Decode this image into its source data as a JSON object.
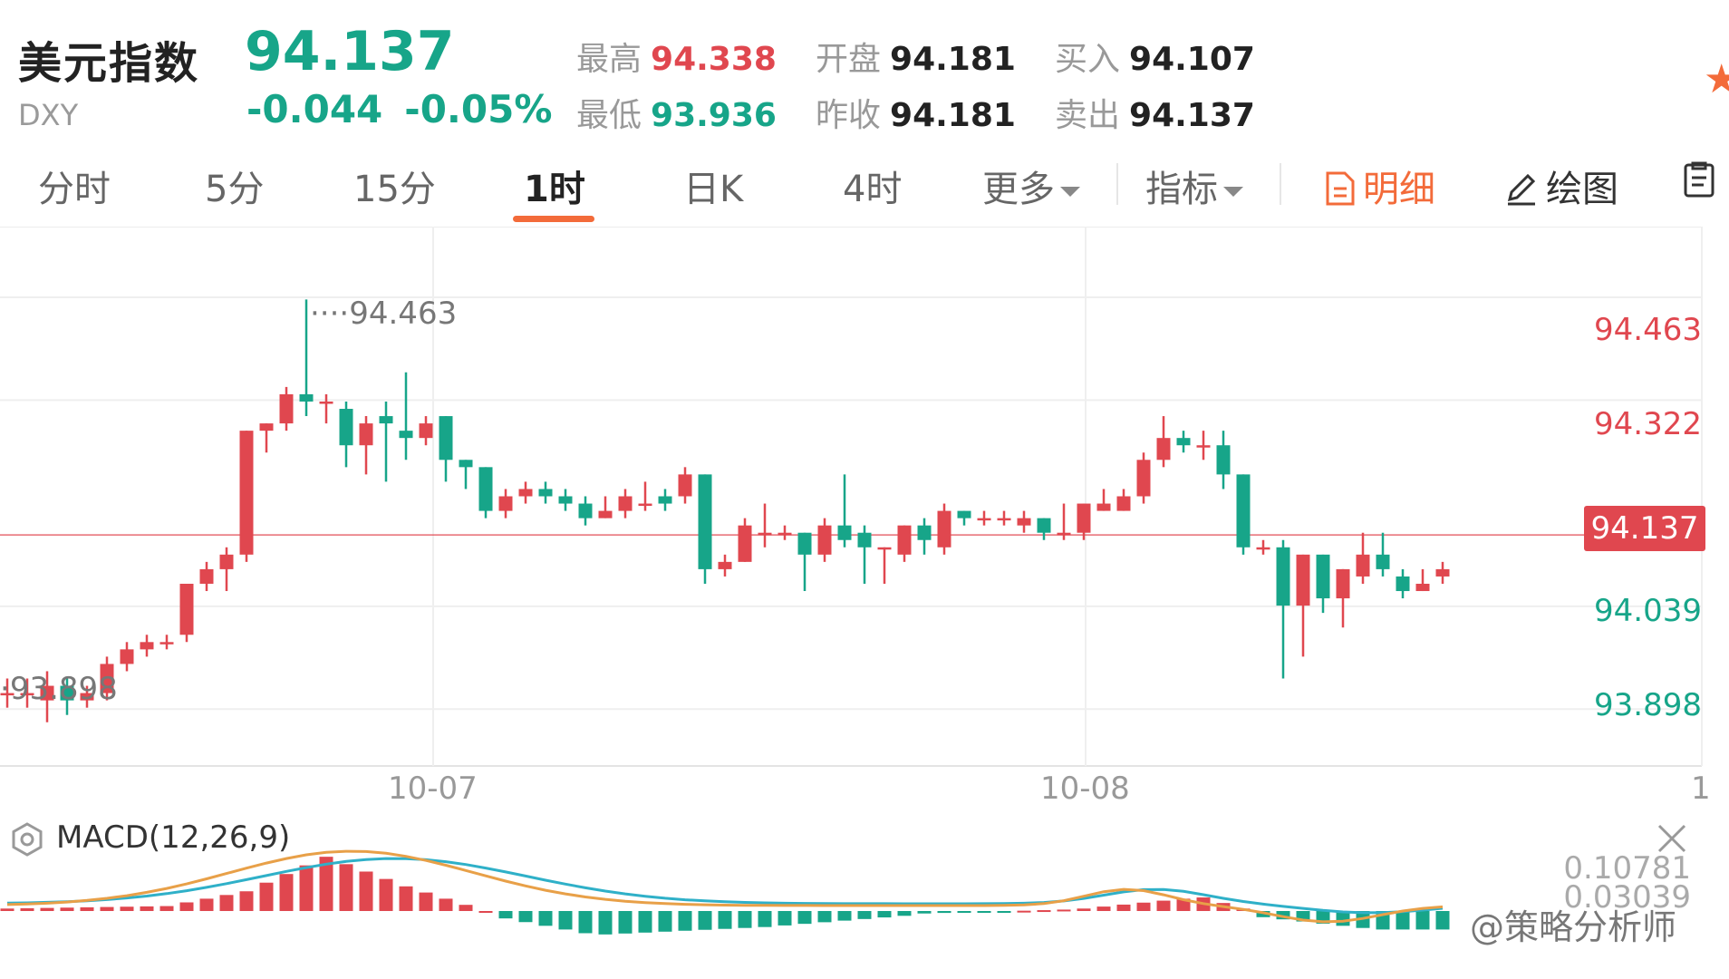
{
  "header": {
    "name": "美元指数",
    "code": "DXY",
    "price": "94.137",
    "change": "-0.044",
    "change_pct": "-0.05%",
    "stats": {
      "high_label": "最高",
      "high": "94.338",
      "low_label": "最低",
      "low": "93.936",
      "open_label": "开盘",
      "open": "94.181",
      "prev_close_label": "昨收",
      "prev_close": "94.181",
      "bid_label": "买入",
      "bid": "94.107",
      "ask_label": "卖出",
      "ask": "94.137"
    }
  },
  "tabs": {
    "fenshi": "分时",
    "min5": "5分",
    "min15": "15分",
    "hour1": "1时",
    "day": "日K",
    "hour4": "4时",
    "more": "更多",
    "indicator": "指标",
    "detail": "明细",
    "draw": "绘图",
    "active": "1时"
  },
  "chart": {
    "price_labels": [
      "94.463",
      "94.322",
      "94.137",
      "94.039",
      "93.898"
    ],
    "current_price": "94.137",
    "high_annotation": "94.463",
    "low_annotation": "93.898",
    "dates": [
      "10-07",
      "10-08",
      "1"
    ],
    "macd_title": "MACD(12,26,9)",
    "macd_values": [
      "0.10781",
      "0.03039"
    ]
  },
  "watermark": "@策略分析师",
  "colors": {
    "up": "#e0474f",
    "down": "#17a589",
    "accent": "#f36b3a",
    "macd_dif": "#2fb0c8",
    "macd_dea": "#e8a048"
  },
  "chart_data": {
    "type": "candlestick",
    "ylim": [
      93.82,
      94.56
    ],
    "candles": [
      [
        93.92,
        93.92,
        93.9,
        93.94
      ],
      [
        93.92,
        93.92,
        93.9,
        93.94
      ],
      [
        93.91,
        93.93,
        93.88,
        93.95
      ],
      [
        93.93,
        93.91,
        93.89,
        93.94
      ],
      [
        93.91,
        93.92,
        93.9,
        93.93
      ],
      [
        93.92,
        93.96,
        93.91,
        93.97
      ],
      [
        93.96,
        93.98,
        93.95,
        93.99
      ],
      [
        93.98,
        93.99,
        93.97,
        94.0
      ],
      [
        93.99,
        93.99,
        93.98,
        94.0
      ],
      [
        94.0,
        94.07,
        93.99,
        94.07
      ],
      [
        94.07,
        94.09,
        94.06,
        94.1
      ],
      [
        94.09,
        94.11,
        94.06,
        94.12
      ],
      [
        94.11,
        94.28,
        94.1,
        94.28
      ],
      [
        94.28,
        94.29,
        94.25,
        94.29
      ],
      [
        94.29,
        94.33,
        94.28,
        94.34
      ],
      [
        94.33,
        94.32,
        94.3,
        94.46
      ],
      [
        94.32,
        94.32,
        94.29,
        94.33
      ],
      [
        94.31,
        94.26,
        94.23,
        94.32
      ],
      [
        94.26,
        94.29,
        94.22,
        94.3
      ],
      [
        94.3,
        94.29,
        94.21,
        94.32
      ],
      [
        94.28,
        94.27,
        94.24,
        94.36
      ],
      [
        94.27,
        94.29,
        94.26,
        94.3
      ],
      [
        94.3,
        94.24,
        94.21,
        94.3
      ],
      [
        94.24,
        94.23,
        94.2,
        94.24
      ],
      [
        94.23,
        94.17,
        94.16,
        94.23
      ],
      [
        94.17,
        94.19,
        94.16,
        94.2
      ],
      [
        94.19,
        94.2,
        94.18,
        94.21
      ],
      [
        94.2,
        94.19,
        94.18,
        94.21
      ],
      [
        94.19,
        94.18,
        94.17,
        94.2
      ],
      [
        94.18,
        94.16,
        94.15,
        94.19
      ],
      [
        94.16,
        94.17,
        94.16,
        94.19
      ],
      [
        94.17,
        94.19,
        94.16,
        94.2
      ],
      [
        94.18,
        94.18,
        94.17,
        94.21
      ],
      [
        94.19,
        94.18,
        94.17,
        94.2
      ],
      [
        94.19,
        94.22,
        94.18,
        94.23
      ],
      [
        94.22,
        94.09,
        94.07,
        94.22
      ],
      [
        94.09,
        94.1,
        94.08,
        94.11
      ],
      [
        94.1,
        94.15,
        94.1,
        94.16
      ],
      [
        94.14,
        94.14,
        94.12,
        94.18
      ],
      [
        94.14,
        94.14,
        94.13,
        94.15
      ],
      [
        94.14,
        94.11,
        94.06,
        94.14
      ],
      [
        94.11,
        94.15,
        94.1,
        94.16
      ],
      [
        94.15,
        94.13,
        94.12,
        94.22
      ],
      [
        94.14,
        94.12,
        94.07,
        94.15
      ],
      [
        94.12,
        94.12,
        94.07,
        94.12
      ],
      [
        94.11,
        94.15,
        94.1,
        94.15
      ],
      [
        94.15,
        94.13,
        94.11,
        94.16
      ],
      [
        94.12,
        94.17,
        94.11,
        94.18
      ],
      [
        94.17,
        94.16,
        94.15,
        94.17
      ],
      [
        94.16,
        94.16,
        94.15,
        94.17
      ],
      [
        94.16,
        94.16,
        94.15,
        94.17
      ],
      [
        94.15,
        94.16,
        94.14,
        94.17
      ],
      [
        94.16,
        94.14,
        94.13,
        94.16
      ],
      [
        94.14,
        94.14,
        94.13,
        94.18
      ],
      [
        94.14,
        94.18,
        94.13,
        94.18
      ],
      [
        94.17,
        94.18,
        94.17,
        94.2
      ],
      [
        94.17,
        94.19,
        94.17,
        94.2
      ],
      [
        94.19,
        94.24,
        94.18,
        94.25
      ],
      [
        94.24,
        94.27,
        94.23,
        94.3
      ],
      [
        94.27,
        94.26,
        94.25,
        94.28
      ],
      [
        94.26,
        94.26,
        94.24,
        94.28
      ],
      [
        94.26,
        94.22,
        94.2,
        94.28
      ],
      [
        94.22,
        94.12,
        94.11,
        94.22
      ],
      [
        94.12,
        94.12,
        94.11,
        94.13
      ],
      [
        94.12,
        94.04,
        93.94,
        94.13
      ],
      [
        94.04,
        94.11,
        93.97,
        94.11
      ],
      [
        94.11,
        94.05,
        94.03,
        94.11
      ],
      [
        94.05,
        94.09,
        94.01,
        94.09
      ],
      [
        94.08,
        94.11,
        94.07,
        94.14
      ],
      [
        94.11,
        94.09,
        94.08,
        94.14
      ],
      [
        94.08,
        94.06,
        94.05,
        94.09
      ],
      [
        94.06,
        94.07,
        94.06,
        94.09
      ],
      [
        94.08,
        94.09,
        94.07,
        94.1
      ]
    ]
  }
}
